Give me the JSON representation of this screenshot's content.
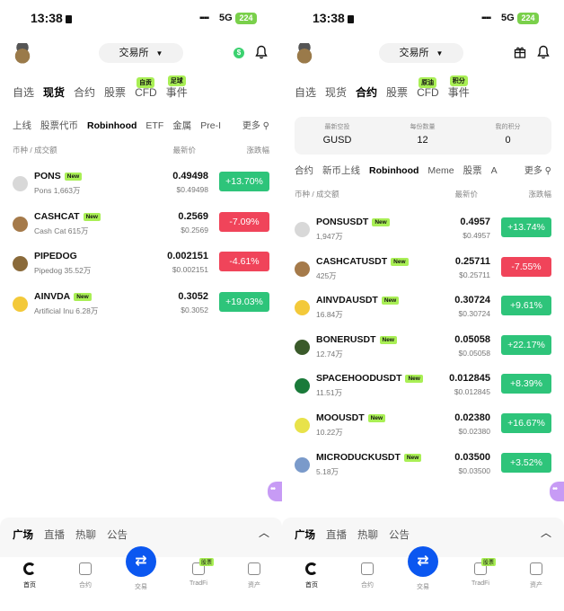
{
  "status": {
    "time": "13:38",
    "network": "5G",
    "battery": "224"
  },
  "left": {
    "exchange_label": "交易所",
    "main_tabs": [
      {
        "label": "自选",
        "active": false,
        "badge": ""
      },
      {
        "label": "现货",
        "active": true,
        "badge": ""
      },
      {
        "label": "合约",
        "active": false,
        "badge": ""
      },
      {
        "label": "股票",
        "active": false,
        "badge": ""
      },
      {
        "label": "CFD",
        "active": false,
        "badge": "自贡"
      },
      {
        "label": "事件",
        "active": false,
        "badge": "足球"
      }
    ],
    "sub_tabs": [
      "上线",
      "股票代币",
      "Robinhood",
      "ETF",
      "金属",
      "Pre-I"
    ],
    "sub_active": "Robinhood",
    "more_label": "更多",
    "col_headers": {
      "pair": "币种 / 成交额",
      "price": "最新价",
      "change": "涨跌幅"
    },
    "rows": [
      {
        "symbol": "PONS",
        "sub": "Pons 1,663万",
        "price": "0.49498",
        "usd": "$0.49498",
        "change": "+13.70%",
        "dir": "up",
        "new": true
      },
      {
        "symbol": "CASHCAT",
        "sub": "Cash Cat 615万",
        "price": "0.2569",
        "usd": "$0.2569",
        "change": "-7.09%",
        "dir": "down",
        "new": true
      },
      {
        "symbol": "PIPEDOG",
        "sub": "Pipedog 35.52万",
        "price": "0.002151",
        "usd": "$0.002151",
        "change": "-4.61%",
        "dir": "down",
        "new": false
      },
      {
        "symbol": "AINVDA",
        "sub": "Artificial Inu 6.28万",
        "price": "0.3052",
        "usd": "$0.3052",
        "change": "+19.03%",
        "dir": "up",
        "new": true
      }
    ]
  },
  "right": {
    "exchange_label": "交易所",
    "main_tabs": [
      {
        "label": "自选",
        "active": false,
        "badge": ""
      },
      {
        "label": "现货",
        "active": false,
        "badge": ""
      },
      {
        "label": "合约",
        "active": true,
        "badge": ""
      },
      {
        "label": "股票",
        "active": false,
        "badge": ""
      },
      {
        "label": "CFD",
        "active": false,
        "badge": "原油"
      },
      {
        "label": "事件",
        "active": false,
        "badge": "积分"
      }
    ],
    "stats": [
      {
        "label": "最新空投",
        "value": "GUSD"
      },
      {
        "label": "每份数量",
        "value": "12"
      },
      {
        "label": "我的积分",
        "value": "0"
      }
    ],
    "sub_tabs": [
      "合约",
      "新币上线",
      "Robinhood",
      "Meme",
      "股票",
      "A"
    ],
    "sub_active": "Robinhood",
    "more_label": "更多",
    "col_headers": {
      "pair": "币种 / 成交额",
      "price": "最新价",
      "change": "涨跌幅"
    },
    "rows": [
      {
        "symbol": "PONSUSDT",
        "sub": "1,947万",
        "price": "0.4957",
        "usd": "$0.4957",
        "change": "+13.74%",
        "dir": "up",
        "new": true
      },
      {
        "symbol": "CASHCATUSDT",
        "sub": "425万",
        "price": "0.25711",
        "usd": "$0.25711",
        "change": "-7.55%",
        "dir": "down",
        "new": true
      },
      {
        "symbol": "AINVDAUSDT",
        "sub": "16.84万",
        "price": "0.30724",
        "usd": "$0.30724",
        "change": "+9.61%",
        "dir": "up",
        "new": true
      },
      {
        "symbol": "BONERUSDT",
        "sub": "12.74万",
        "price": "0.05058",
        "usd": "$0.05058",
        "change": "+22.17%",
        "dir": "up",
        "new": true
      },
      {
        "symbol": "SPACEHOODUSDT",
        "sub": "11.51万",
        "price": "0.012845",
        "usd": "$0.012845",
        "change": "+8.39%",
        "dir": "up",
        "new": true
      },
      {
        "symbol": "MOOUSDT",
        "sub": "10.22万",
        "price": "0.02380",
        "usd": "$0.02380",
        "change": "+16.67%",
        "dir": "up",
        "new": true
      },
      {
        "symbol": "MICRODUCKUSDT",
        "sub": "5.18万",
        "price": "0.03500",
        "usd": "$0.03500",
        "change": "+3.52%",
        "dir": "up",
        "new": true
      }
    ]
  },
  "new_label": "New",
  "sheet_tabs": [
    "广场",
    "直播",
    "热聊",
    "公告"
  ],
  "nav": [
    {
      "label": "首页",
      "icon": "home-icon",
      "active": true
    },
    {
      "label": "合约",
      "icon": "contract-icon",
      "active": false
    },
    {
      "label": "交易",
      "icon": "swap-icon",
      "active": false
    },
    {
      "label": "TradFi",
      "icon": "tradfi-icon",
      "active": false,
      "badge": "股票"
    },
    {
      "label": "资产",
      "icon": "wallet-icon",
      "active": false
    }
  ],
  "colors": {
    "up": "#2ec47a",
    "down": "#f0445a",
    "accent": "#0b57f0",
    "badge": "#a9ef55"
  }
}
